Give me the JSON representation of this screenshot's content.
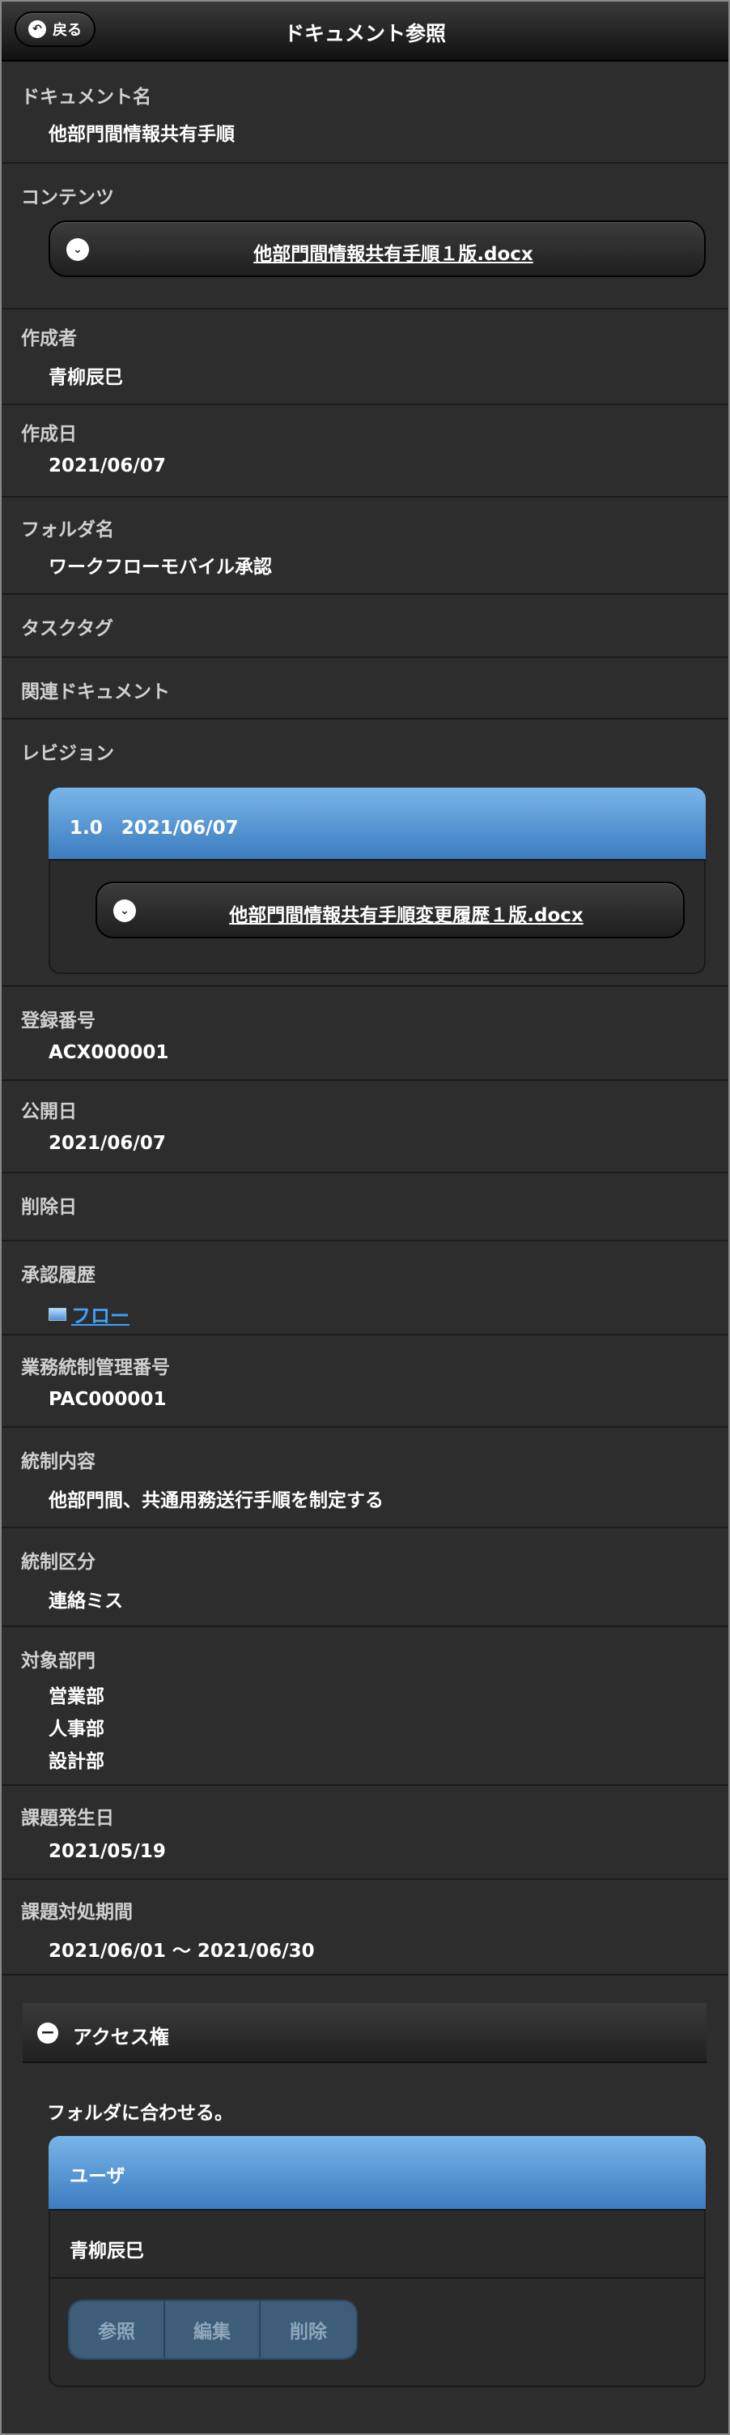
{
  "header": {
    "back_label": "戻る",
    "title": "ドキュメント参照"
  },
  "fields": {
    "document_name": {
      "label": "ドキュメント名",
      "value": "他部門間情報共有手順"
    },
    "contents": {
      "label": "コンテンツ",
      "file": "他部門間情報共有手順１版.docx"
    },
    "author": {
      "label": "作成者",
      "value": "青柳辰巳"
    },
    "created": {
      "label": "作成日",
      "value": "2021/06/07"
    },
    "folder": {
      "label": "フォルダ名",
      "value": "ワークフローモバイル承認"
    },
    "task_tag": {
      "label": "タスクタグ"
    },
    "related": {
      "label": "関連ドキュメント"
    },
    "revision": {
      "label": "レビジョン",
      "header": "1.0　2021/06/07",
      "file": "他部門間情報共有手順変更履歴１版.docx"
    },
    "reg_no": {
      "label": "登録番号",
      "value": "ACX000001"
    },
    "published": {
      "label": "公開日",
      "value": "2021/06/07"
    },
    "deleted": {
      "label": "削除日"
    },
    "approval": {
      "label": "承認履歴",
      "link": "フロー"
    },
    "control_no": {
      "label": "業務統制管理番号",
      "value": "PAC000001"
    },
    "control_content": {
      "label": "統制内容",
      "value": "他部門間、共通用務送行手順を制定する"
    },
    "control_class": {
      "label": "統制区分",
      "value": "連絡ミス"
    },
    "departments": {
      "label": "対象部門",
      "values": [
        "営業部",
        "人事部",
        "設計部"
      ]
    },
    "issue_date": {
      "label": "課題発生日",
      "value": "2021/05/19"
    },
    "issue_period": {
      "label": "課題対処期間",
      "value": "2021/06/01 〜 2021/06/30"
    }
  },
  "access": {
    "title": "アクセス権",
    "note": "フォルダに合わせる。",
    "user_header": "ユーザ",
    "user": "青柳辰巳",
    "buttons": [
      "参照",
      "編集",
      "削除"
    ]
  }
}
